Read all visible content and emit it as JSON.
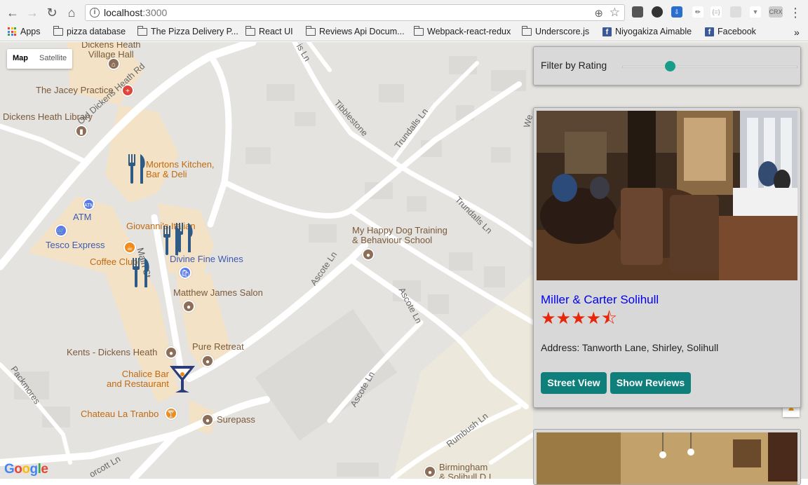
{
  "browser": {
    "url_host": "localhost",
    "url_port": ":3000",
    "bookmarks": [
      {
        "label": "Apps",
        "icon": "apps-grid-icon"
      },
      {
        "label": "pizza database",
        "icon": "folder-icon"
      },
      {
        "label": "The Pizza Delivery P...",
        "icon": "folder-icon"
      },
      {
        "label": "React UI",
        "icon": "folder-icon"
      },
      {
        "label": "Reviews Api Docum...",
        "icon": "folder-icon"
      },
      {
        "label": "Webpack-react-redux",
        "icon": "folder-icon"
      },
      {
        "label": "Underscore.js",
        "icon": "folder-icon"
      },
      {
        "label": "Niyogakiza Aimable",
        "icon": "facebook-icon"
      },
      {
        "label": "Facebook",
        "icon": "facebook-icon"
      }
    ],
    "more_bookmarks": "»",
    "ext_crx": "CRX"
  },
  "map": {
    "type_controls": {
      "map": "Map",
      "satellite": "Satellite"
    },
    "google_logo": [
      "G",
      "o",
      "o",
      "g",
      "l",
      "e"
    ],
    "labels": {
      "village_hall": [
        "Dickens Heath",
        "Village Hall"
      ],
      "jacey": "The Jacey Practice",
      "library": "Dickens Heath Library",
      "old_dickens": "Old Dickens Heath Rd",
      "mortons": [
        "Mortons Kitchen,",
        "Bar & Deli"
      ],
      "atm": "ATM",
      "tesco": "Tesco Express",
      "giovanni": "Giovanni's Italian",
      "coffee": "Coffee Club",
      "divine": "Divine Fine Wines",
      "main_st": "Main St",
      "matthew": "Matthew James Salon",
      "kents": "Kents - Dickens Heath",
      "pure": "Pure Retreat",
      "chalice": [
        "Chalice Bar",
        "and Restaurant"
      ],
      "chateau": "Chateau La Tranbo",
      "surepass": "Surepass",
      "dog": [
        "My Happy Dog Training",
        "& Behaviour School"
      ],
      "ascote1": "Ascote Ln",
      "ascote2": "Ascote Ln",
      "ascote3": "Ascote Ln",
      "tibblestone": "Tibblestone",
      "trundalls1": "Trundalls Ln",
      "trundalls2": "Trundalls Ln",
      "rumbush": "Rumbush Ln",
      "packmores": "Packmores",
      "corcott": "orcott Ln",
      "birmingham": [
        "Birmingham",
        "& Solihull D I"
      ],
      "is_ln": "is Ln",
      "we": "We"
    }
  },
  "filter": {
    "label": "Filter by Rating",
    "value_fraction": 0.27
  },
  "restaurant": {
    "name": "Miller & Carter Solihull",
    "rating": 4.5,
    "stars": [
      "★",
      "★",
      "★",
      "★",
      "⯪"
    ],
    "address": "Address: Tanworth Lane, Shirley, Solihull",
    "street_view_label": "Street View",
    "reviews_label": "Show Reviews"
  },
  "colors": {
    "accent": "#0e7f7a",
    "slider": "#1a9c8a",
    "star": "#e8270a",
    "link": "#0000ee"
  }
}
